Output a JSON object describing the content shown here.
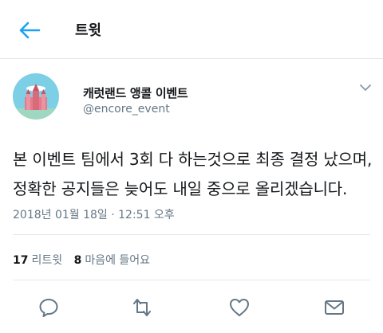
{
  "header": {
    "title": "트윗"
  },
  "tweet": {
    "display_name": "캐럿랜드 앵콜 이벤트",
    "handle": "@encore_event",
    "line1": "본 이벤트 팀에서 3회 다 하는것으로 최종 결정 났으며,",
    "line2": "정확한 공지들은 늦어도 내일 중으로 올리겠습니다.",
    "timestamp": "2018년 01월 18일 · 12:51 오후",
    "retweet_count": "17",
    "retweet_label": "리트윗",
    "like_count": "8",
    "like_label": "마음에 들어요"
  },
  "colors": {
    "accent": "#1da1f2",
    "secondary_text": "#657786",
    "divider": "#e1e8ed"
  }
}
